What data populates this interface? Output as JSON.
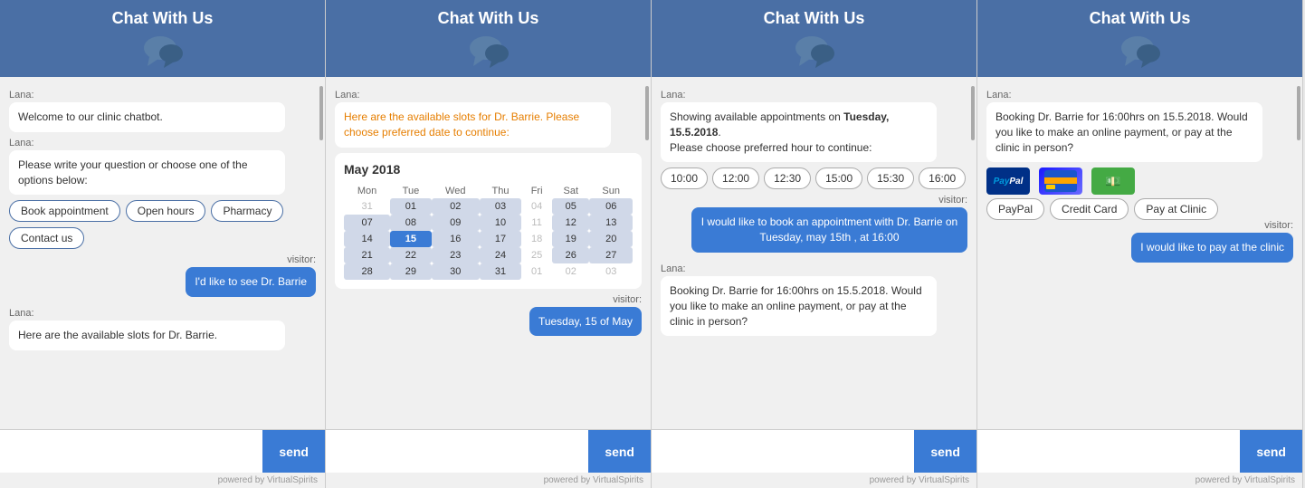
{
  "widgets": [
    {
      "id": "widget1",
      "header": {
        "title": "Chat With Us"
      },
      "messages": [
        {
          "type": "lana",
          "label": "Lana:",
          "text": "Welcome to our clinic chatbot."
        },
        {
          "type": "lana",
          "label": "Lana:",
          "text": "Please write your question or choose one of the options below:"
        },
        {
          "type": "options",
          "buttons": [
            "Book appointment",
            "Open hours",
            "Pharmacy",
            "Contact us"
          ]
        },
        {
          "type": "visitor_label",
          "label": "visitor:"
        },
        {
          "type": "visitor",
          "text": "I'd like to see Dr. Barrie"
        },
        {
          "type": "lana",
          "label": "Lana:",
          "text": "Here are the available slots for Dr. Barrie."
        }
      ],
      "input_placeholder": "",
      "send_label": "send",
      "powered_by": "powered by VirtualSpirits"
    },
    {
      "id": "widget2",
      "header": {
        "title": "Chat With Us"
      },
      "messages": [
        {
          "type": "lana_orange",
          "label": "Lana:",
          "text": "Here are the available slots for Dr. Barrie. Please choose preferred date to continue:"
        },
        {
          "type": "calendar",
          "month": "May 2018",
          "selected": 15
        },
        {
          "type": "visitor_label",
          "label": "visitor:"
        },
        {
          "type": "visitor",
          "text": "Tuesday, 15 of May"
        }
      ],
      "input_placeholder": "",
      "send_label": "send",
      "powered_by": "powered by VirtualSpirits"
    },
    {
      "id": "widget3",
      "header": {
        "title": "Chat With Us"
      },
      "messages": [
        {
          "type": "lana",
          "label": "Lana:",
          "text_html": "Showing available appointments on <b>Tuesday, 15.5.2018</b>."
        },
        {
          "type": "lana_plain",
          "text": "Please choose preferred hour to continue:"
        },
        {
          "type": "timeslots",
          "slots": [
            "10:00",
            "12:00",
            "12:30",
            "15:00",
            "15:30",
            "16:00"
          ]
        },
        {
          "type": "visitor_label",
          "label": "visitor:"
        },
        {
          "type": "visitor",
          "text": "I would like to book an appointment with Dr. Barrie on Tuesday, may 15th , at 16:00"
        },
        {
          "type": "lana",
          "label": "Lana:",
          "text": "Booking Dr. Barrie for 16:00hrs on 15.5.2018. Would you like to make an online payment, or pay at the clinic in person?"
        }
      ],
      "input_placeholder": "",
      "send_label": "send",
      "powered_by": "powered by VirtualSpirits"
    },
    {
      "id": "widget4",
      "header": {
        "title": "Chat With Us"
      },
      "messages": [
        {
          "type": "lana",
          "label": "Lana:",
          "text": "Booking Dr. Barrie for 16:00hrs on 15.5.2018. Would you like to make an online payment, or pay at the clinic in person?"
        },
        {
          "type": "payment_icons"
        },
        {
          "type": "payment_buttons",
          "buttons": [
            "PayPal",
            "Credit Card",
            "Pay at Clinic"
          ]
        },
        {
          "type": "visitor_label",
          "label": "visitor:"
        },
        {
          "type": "visitor",
          "text": "I would like to pay at the clinic"
        }
      ],
      "input_placeholder": "",
      "send_label": "send",
      "powered_by": "powered by VirtualSpirits"
    }
  ],
  "calendar": {
    "month": "May 2018",
    "days_header": [
      "Mon",
      "Tue",
      "Wed",
      "Thu",
      "Fri",
      "Sat",
      "Sun"
    ],
    "weeks": [
      [
        {
          "d": "31",
          "cls": "inactive"
        },
        {
          "d": "01",
          "cls": "available"
        },
        {
          "d": "02",
          "cls": "available"
        },
        {
          "d": "03",
          "cls": "available"
        },
        {
          "d": "04",
          "cls": "inactive"
        },
        {
          "d": "05",
          "cls": "available"
        },
        {
          "d": "06",
          "cls": "available"
        }
      ],
      [
        {
          "d": "07",
          "cls": "available"
        },
        {
          "d": "08",
          "cls": "available"
        },
        {
          "d": "09",
          "cls": "available"
        },
        {
          "d": "10",
          "cls": "available"
        },
        {
          "d": "11",
          "cls": "inactive"
        },
        {
          "d": "12",
          "cls": "available"
        },
        {
          "d": "13",
          "cls": "available"
        }
      ],
      [
        {
          "d": "14",
          "cls": "available"
        },
        {
          "d": "15",
          "cls": "selected"
        },
        {
          "d": "16",
          "cls": "available"
        },
        {
          "d": "17",
          "cls": "available"
        },
        {
          "d": "18",
          "cls": "inactive"
        },
        {
          "d": "19",
          "cls": "available"
        },
        {
          "d": "20",
          "cls": "available"
        }
      ],
      [
        {
          "d": "21",
          "cls": "available"
        },
        {
          "d": "22",
          "cls": "available"
        },
        {
          "d": "23",
          "cls": "available"
        },
        {
          "d": "24",
          "cls": "available"
        },
        {
          "d": "25",
          "cls": "inactive"
        },
        {
          "d": "26",
          "cls": "available"
        },
        {
          "d": "27",
          "cls": "available"
        }
      ],
      [
        {
          "d": "28",
          "cls": "available"
        },
        {
          "d": "29",
          "cls": "available"
        },
        {
          "d": "30",
          "cls": "available"
        },
        {
          "d": "31",
          "cls": "available"
        },
        {
          "d": "01",
          "cls": "inactive"
        },
        {
          "d": "02",
          "cls": "inactive"
        },
        {
          "d": "03",
          "cls": "inactive"
        }
      ]
    ]
  }
}
